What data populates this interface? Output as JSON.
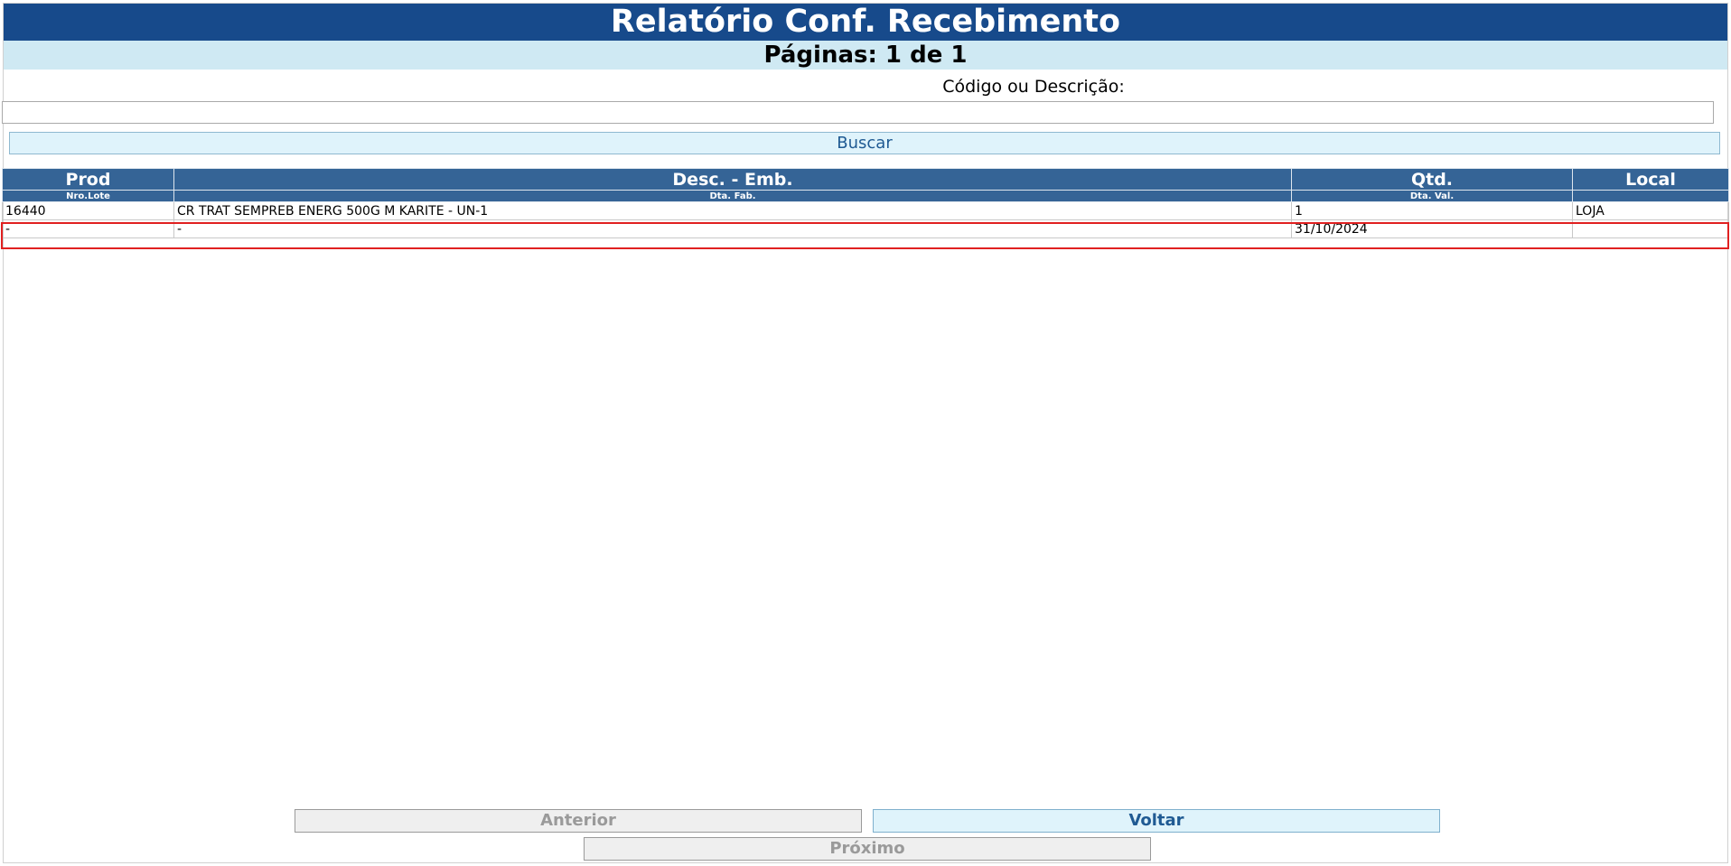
{
  "header": {
    "title": "Relatório Conf. Recebimento",
    "pages": "Páginas: 1 de 1"
  },
  "search": {
    "label": "Código ou Descrição:",
    "value": "",
    "button_label": "Buscar"
  },
  "table": {
    "headers": [
      "Prod",
      "Desc. - Emb.",
      "Qtd.",
      "Local"
    ],
    "subheaders": [
      "Nro.Lote",
      "Dta. Fab.",
      "Dta. Val.",
      ""
    ],
    "rows": [
      [
        "16440",
        "CR TRAT SEMPREB ENERG 500G M KARITE - UN-1",
        "1",
        "LOJA"
      ],
      [
        "-",
        "-",
        "31/10/2024",
        ""
      ]
    ]
  },
  "nav": {
    "previous_label": "Anterior",
    "back_label": "Voltar",
    "next_label": "Próximo"
  },
  "colors": {
    "title_bg": "#174a8b",
    "pages_bg": "#cfe9f3",
    "table_header_bg": "#356496",
    "highlight": "#e02020"
  }
}
